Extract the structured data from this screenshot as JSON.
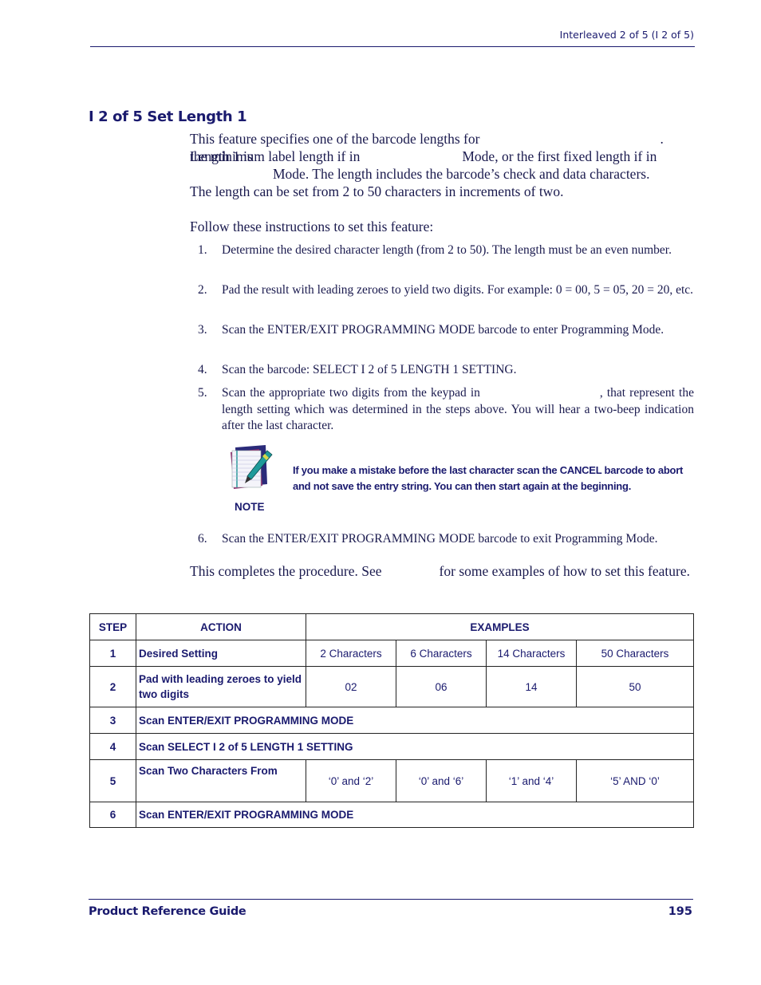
{
  "header": {
    "running_title": "Interleaved 2 of 5 (I 2 of 5)"
  },
  "section": {
    "title": "I 2 of 5 Set Length 1",
    "intro": {
      "line1a": "This feature specifies one of the barcode lengths for",
      "line1b": ". Length 1 is",
      "line2a": "the minimum label length if in",
      "line2b": "Mode, or the first fixed length if in",
      "line3": "Mode. The length includes the barcode’s check and data characters.",
      "line4": "The length can be set from 2 to 50 characters in increments of two."
    },
    "instructions_lead": "Follow these instructions to set this feature:",
    "steps": [
      {
        "num": "1.",
        "text": "Determine the desired character length (from 2 to 50). The length must be an even number."
      },
      {
        "num": "2.",
        "text": "Pad the result with leading zeroes to yield two digits. For example: 0 = 00, 5 = 05, 20 = 20, etc."
      },
      {
        "num": "3.",
        "text": "Scan the ENTER/EXIT PROGRAMMING MODE barcode to enter Programming Mode."
      },
      {
        "num": "4.",
        "text": "Scan the barcode: SELECT I 2 of 5 LENGTH 1 SETTING."
      },
      {
        "num": "5.",
        "text_a": "Scan the appropriate two digits from the keypad in",
        "text_b": ", that represent the length setting which was determined in the steps above. You will hear a two-beep indication after the last character."
      },
      {
        "num": "6.",
        "text": "Scan the ENTER/EXIT PROGRAMMING MODE barcode to exit Programming Mode."
      }
    ],
    "note": {
      "icon": "notepad-pen-icon",
      "label": "NOTE",
      "text": "If you make a mistake before the last character scan the CANCEL barcode to abort and not save the entry string. You can then start again at the beginning."
    },
    "closing_a": "This completes the procedure. See",
    "closing_b": "for some examples of how to set this feature."
  },
  "table": {
    "headers": {
      "step": "STEP",
      "action": "ACTION",
      "examples": "EXAMPLES"
    },
    "rows": [
      {
        "step": "1",
        "action": "Desired Setting",
        "examples": [
          "2 Characters",
          "6 Characters",
          "14 Characters",
          "50 Characters"
        ]
      },
      {
        "step": "2",
        "action": "Pad with leading zeroes to yield two digits",
        "examples": [
          "02",
          "06",
          "14",
          "50"
        ]
      },
      {
        "step": "3",
        "action": "Scan ENTER/EXIT PROGRAMMING MODE"
      },
      {
        "step": "4",
        "action": "Scan SELECT I 2 of 5 LENGTH 1 SETTING"
      },
      {
        "step": "5",
        "action": "Scan Two Characters From",
        "examples": [
          "‘0’ and ‘2’",
          "‘0’ and ‘6’",
          "‘1’ and ‘4’",
          "‘5’ AND ‘0’"
        ]
      },
      {
        "step": "6",
        "action": "Scan ENTER/EXIT PROGRAMMING MODE"
      }
    ]
  },
  "footer": {
    "left": "Product Reference Guide",
    "page_number": "195"
  }
}
